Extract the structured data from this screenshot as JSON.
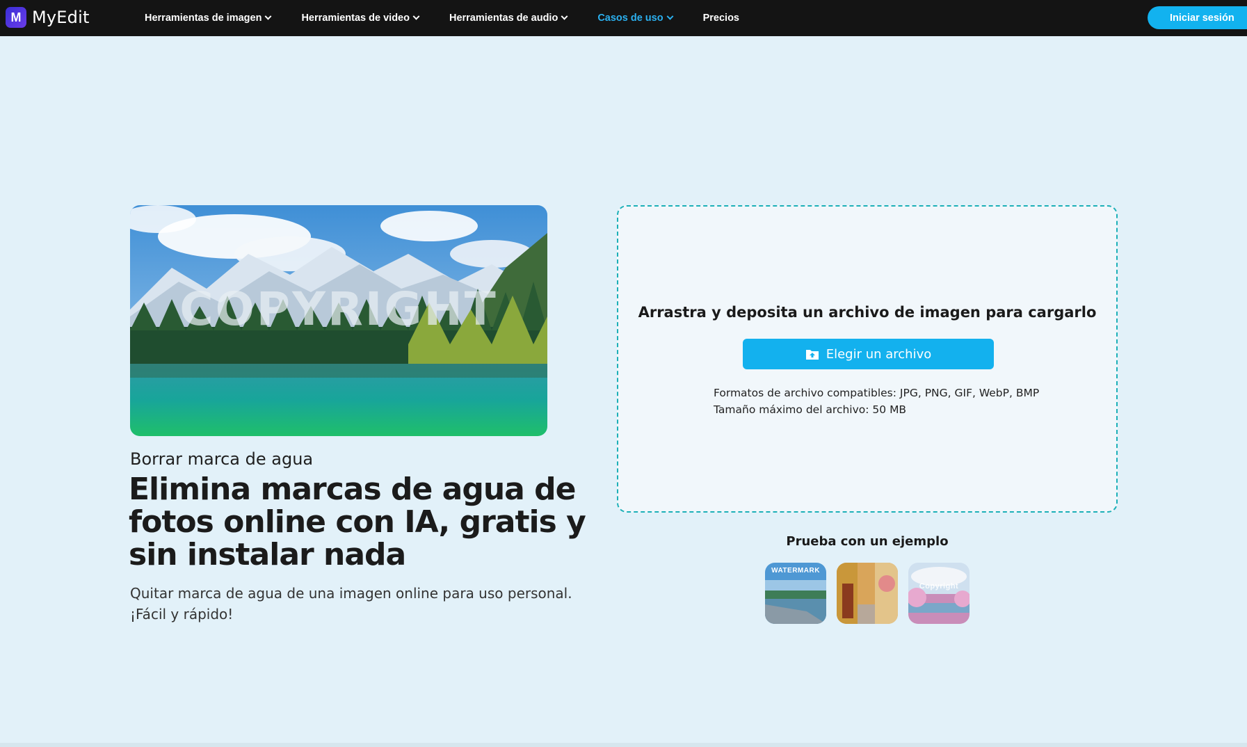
{
  "nav": {
    "brand": "MyEdit",
    "logo_letter": "M",
    "items": [
      {
        "label": "Herramientas de imagen",
        "has_dropdown": true
      },
      {
        "label": "Herramientas de video",
        "has_dropdown": true
      },
      {
        "label": "Herramientas de audio",
        "has_dropdown": true
      },
      {
        "label": "Casos de uso",
        "has_dropdown": true,
        "active": true
      },
      {
        "label": "Precios",
        "has_dropdown": false
      }
    ],
    "login_label": "Iniciar sesión"
  },
  "hero": {
    "watermark_text": "COPYRIGHT",
    "subtitle": "Borrar marca de agua",
    "title": "Elimina marcas de agua de fotos online con IA, gratis y sin instalar nada",
    "description": "Quitar marca de agua de una imagen online para uso personal. ¡Fácil y rápido!"
  },
  "upload": {
    "title": "Arrastra y deposita un archivo de imagen para cargarlo",
    "button_label": "Elegir un archivo",
    "formats": "Formatos de archivo compatibles: JPG, PNG, GIF, WebP, BMP",
    "max_size": "Tamaño máximo del archivo: 50 MB"
  },
  "examples": {
    "title": "Prueba con un ejemplo",
    "items": [
      {
        "label": "WATERMARK"
      },
      {
        "label": ""
      },
      {
        "label": "Copyright"
      }
    ]
  },
  "colors": {
    "accent": "#13b1ee",
    "nav_bg": "#141414",
    "page_bg": "#e2f1f9",
    "dash_border": "#1cb0b8"
  }
}
